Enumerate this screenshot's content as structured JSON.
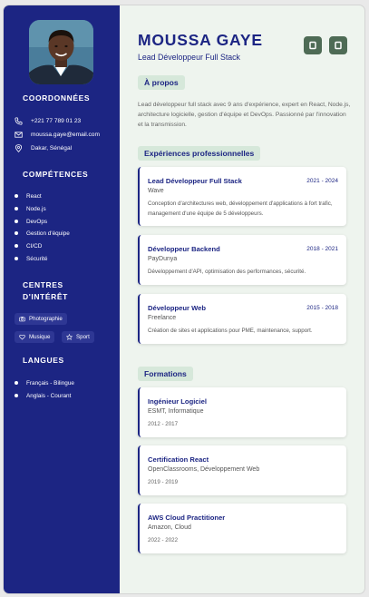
{
  "profile": {
    "name": "MOUSSA GAYE",
    "role": "Lead Développeur Full Stack"
  },
  "colors": {
    "sidebar": "#1c2583",
    "accent_green": "#4e6b55",
    "pill_bg": "#d6e8da",
    "main_bg": "#eef4ee"
  },
  "toolbar": {
    "buttons": [
      {
        "icon": "square-outline-icon"
      },
      {
        "icon": "square-outline-icon"
      }
    ]
  },
  "sidebar": {
    "contact_title": "COORDONNÉES",
    "contacts": [
      {
        "icon": "phone-icon",
        "text": "+221 77 789 01 23"
      },
      {
        "icon": "mail-icon",
        "text": "moussa.gaye@email.com"
      },
      {
        "icon": "location-pin-icon",
        "text": "Dakar, Sénégal"
      }
    ],
    "skills_title": "COMPÉTENCES",
    "skills": [
      "React",
      "Node.js",
      "DevOps",
      "Gestion d'équipe",
      "CI/CD",
      "Sécurité"
    ],
    "interests_title_line1": "CENTRES",
    "interests_title_line2": "D'INTÉRÊT",
    "interests": [
      {
        "icon": "camera-icon",
        "label": "Photographie"
      },
      {
        "icon": "heart-icon",
        "label": "Musique"
      },
      {
        "icon": "star-icon",
        "label": "Sport"
      }
    ],
    "languages_title": "LANGUES",
    "languages": [
      "Français - Bilingue",
      "Anglais - Courant"
    ]
  },
  "about": {
    "title": "À propos",
    "text": "Lead développeur full stack avec 9 ans d'expérience, expert en React, Node.js, architecture logicielle, gestion d'équipe et DevOps. Passionné par l'innovation et la transmission."
  },
  "experience": {
    "title": "Expériences professionnelles",
    "items": [
      {
        "title": "Lead Développeur Full Stack",
        "dates": "2021 - 2024",
        "company": "Wave",
        "description": "Conception d'architectures web, développement d'applications à fort trafic, management d'une équipe de 5 développeurs."
      },
      {
        "title": "Développeur Backend",
        "dates": "2018 - 2021",
        "company": "PayDunya",
        "description": "Développement d'API, optimisation des performances, sécurité."
      },
      {
        "title": "Développeur Web",
        "dates": "2015 - 2018",
        "company": "Freelance",
        "description": "Création de sites et applications pour PME, maintenance, support."
      }
    ]
  },
  "education": {
    "title": "Formations",
    "items": [
      {
        "title": "Ingénieur Logiciel",
        "school": "ESMT, Informatique",
        "dates": "2012 - 2017"
      },
      {
        "title": "Certification React",
        "school": "OpenClassrooms, Développement Web",
        "dates": "2019 - 2019"
      },
      {
        "title": "AWS Cloud Practitioner",
        "school": "Amazon, Cloud",
        "dates": "2022 - 2022"
      }
    ]
  }
}
